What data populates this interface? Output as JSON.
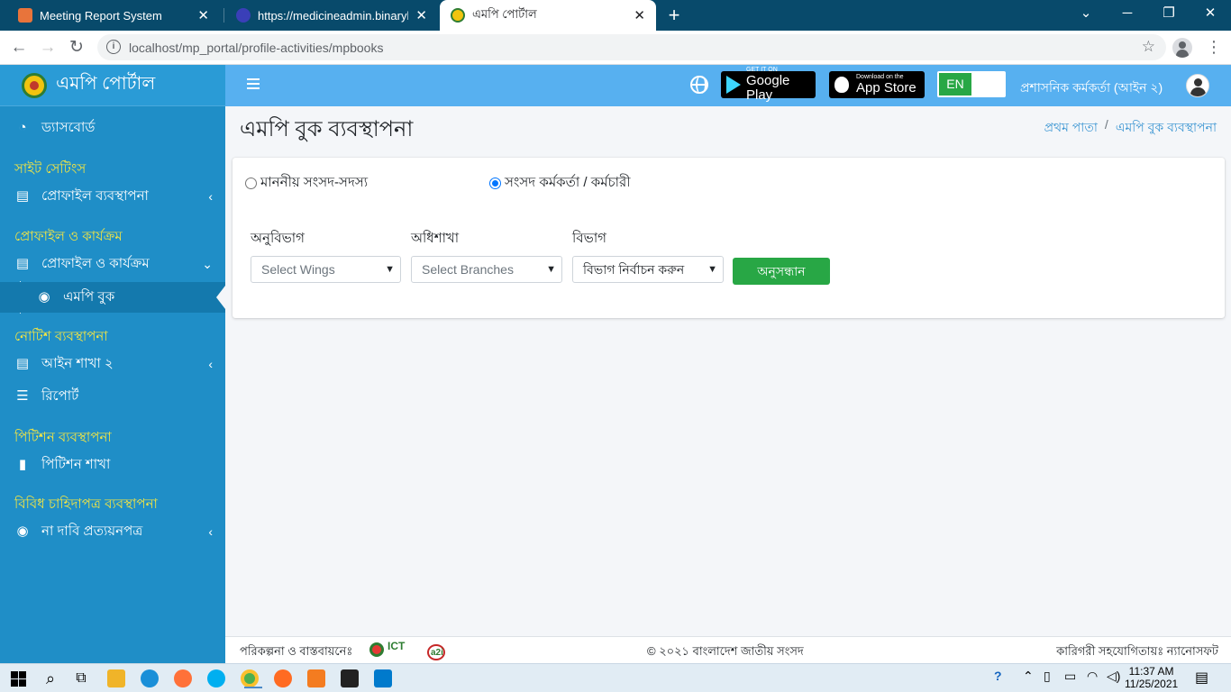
{
  "browser": {
    "tabs": [
      {
        "title": "Meeting Report System",
        "active": false
      },
      {
        "title": "https://medicineadmin.binaryhub",
        "active": false
      },
      {
        "title": "এমপি পোর্টাল",
        "active": true
      }
    ],
    "url": "localhost/mp_portal/profile-activities/mpbooks",
    "new_tab": "+"
  },
  "app": {
    "brand": "এমপি পোর্টাল",
    "google_play": {
      "small": "GET IT ON",
      "big": "Google Play"
    },
    "app_store": {
      "small": "Download on the",
      "big": "App Store"
    },
    "lang": "EN",
    "user": "প্রশাসনিক কর্মকর্তা (আইন ২)"
  },
  "sidebar": {
    "dashboard": "ড্যাসবোর্ড",
    "head_site": "সাইট সেটিংস",
    "profile_mgmt": "প্রোফাইল ব্যবস্থাপনা",
    "head_profile": "প্রোফাইল ও কার্যক্রম",
    "profile_activities": "প্রোফাইল ও কার্যক্রম",
    "mp_book": "এমপি বুক",
    "head_notice": "নোটিশ ব্যবস্থাপনা",
    "law_branch": "আইন শাখা ২",
    "report": "রিপোর্ট",
    "head_petition": "পিটিশন ব্যবস্থাপনা",
    "petition_branch": "পিটিশন শাখা",
    "head_misc": "বিবিধ চাহিদাপত্র ব্যবস্থাপনা",
    "no_claim": "না দাবি প্রত্যয়নপত্র"
  },
  "page": {
    "title": "এমপি বুক ব্যবস্থাপনা",
    "breadcrumb_home": "প্রথম পাতা",
    "breadcrumb_sep": "/",
    "breadcrumb_current": "এমপি বুক ব্যবস্থাপনা"
  },
  "form": {
    "radio_mp": "মাননীয় সংসদ-সদস্য",
    "radio_staff": "সংসদ কর্মকর্তা / কর্মচারী",
    "selected_radio": "radio_staff",
    "label_wing": "অনুবিভাগ",
    "label_branch": "অধিশাখা",
    "label_dept": "বিভাগ",
    "wing_value": "Select Wings",
    "branch_value": "Select Branches",
    "dept_value": "বিভাগ নির্বাচন করুন",
    "search_button": "অনুসন্ধান"
  },
  "footer": {
    "left": "পরিকল্পনা ও বাস্তবায়নেঃ",
    "ict_logo": "ICT",
    "a2i_logo": "a2i",
    "center": "© ২০২১ বাংলাদেশ জাতীয় সংসদ",
    "right": "কারিগরী সহযোগিতায়ঃ ন্যানোসফট"
  },
  "taskbar": {
    "time": "11:37 AM",
    "date": "11/25/2021"
  },
  "colors": {
    "sidebar": "#1f8ec7",
    "header": "#57b0f0",
    "section_heading": "#f5e642",
    "search_button": "#28a745",
    "tab_strip": "#084a6b"
  }
}
